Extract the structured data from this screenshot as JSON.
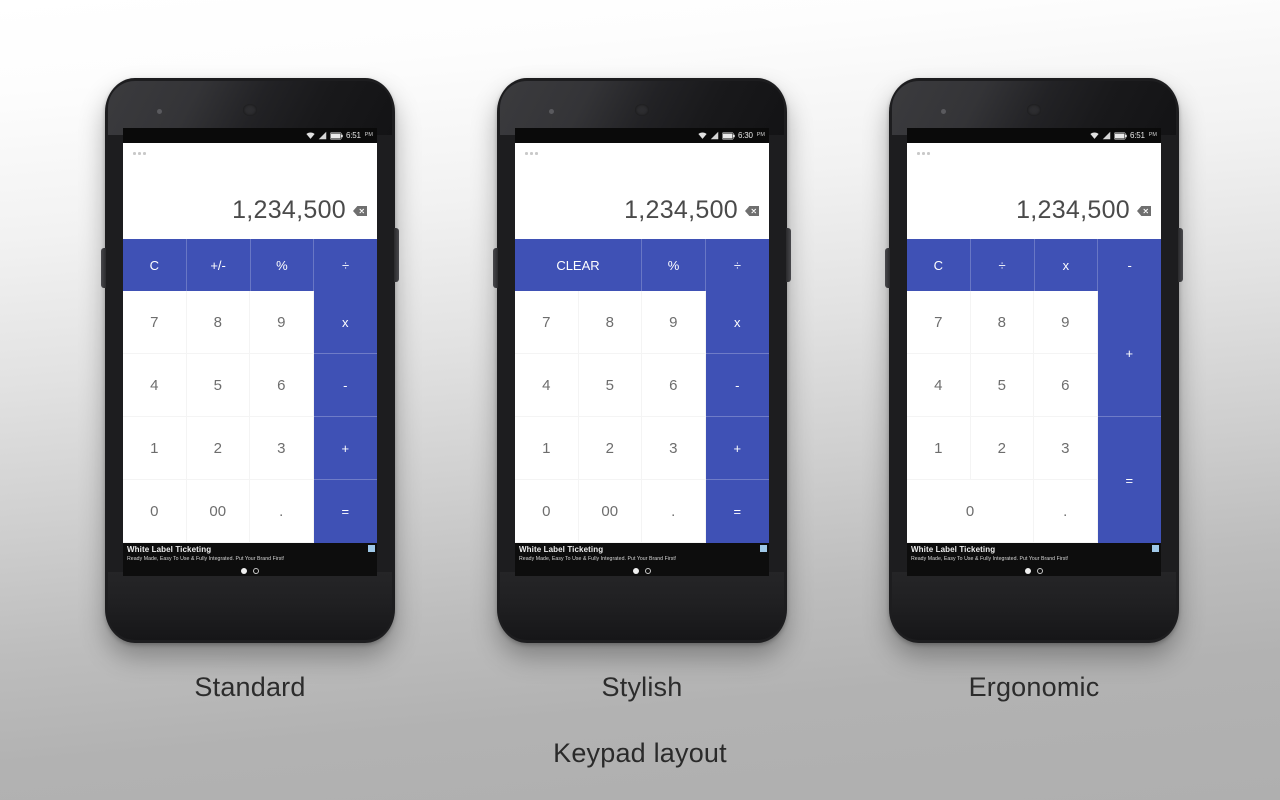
{
  "footer": {
    "label": "Keypad layout"
  },
  "theme": {
    "accent_blue": "#3f51b5",
    "display_text": "#4a4a4a",
    "digit_text": "#6d6d6d",
    "background_top": "#ffffff",
    "background_bottom": "#b0b0b0"
  },
  "phones": [
    {
      "caption": "Standard",
      "status": {
        "time": "6:51",
        "ampm": "PM"
      },
      "display": {
        "value": "1,234,500",
        "backspace_icon": "backspace-icon",
        "menu_icon": "overflow-menu-icon"
      },
      "opbar": [
        {
          "label": "C",
          "name": "clear-key",
          "wide": false
        },
        {
          "label": "+/-",
          "name": "sign-key",
          "wide": false
        },
        {
          "label": "%",
          "name": "percent-key",
          "wide": false
        },
        {
          "label": "÷",
          "name": "divide-key",
          "wide": false
        }
      ],
      "digits": [
        {
          "label": "7",
          "name": "digit-7",
          "span2": false
        },
        {
          "label": "8",
          "name": "digit-8",
          "span2": false
        },
        {
          "label": "9",
          "name": "digit-9",
          "span2": false
        },
        {
          "label": "4",
          "name": "digit-4",
          "span2": false
        },
        {
          "label": "5",
          "name": "digit-5",
          "span2": false
        },
        {
          "label": "6",
          "name": "digit-6",
          "span2": false
        },
        {
          "label": "1",
          "name": "digit-1",
          "span2": false
        },
        {
          "label": "2",
          "name": "digit-2",
          "span2": false
        },
        {
          "label": "3",
          "name": "digit-3",
          "span2": false
        },
        {
          "label": "0",
          "name": "digit-0",
          "span2": false
        },
        {
          "label": "00",
          "name": "digit-00",
          "span2": false
        },
        {
          "label": ".",
          "name": "decimal-point-key",
          "span2": false
        }
      ],
      "ops": [
        {
          "label": "x",
          "name": "multiply-key",
          "rspan2": false
        },
        {
          "label": "-",
          "name": "minus-key",
          "rspan2": false
        },
        {
          "label": "+",
          "name": "plus-key",
          "rspan2": false
        },
        {
          "label": "=",
          "name": "equals-key",
          "rspan2": false
        }
      ],
      "ad": {
        "title": "White Label Ticketing",
        "subtitle": "Ready Made, Easy To Use & Fully Integrated. Put Your Brand First!"
      }
    },
    {
      "caption": "Stylish",
      "status": {
        "time": "6:30",
        "ampm": "PM"
      },
      "display": {
        "value": "1,234,500",
        "backspace_icon": "backspace-icon",
        "menu_icon": "overflow-menu-icon"
      },
      "opbar": [
        {
          "label": "CLEAR",
          "name": "clear-key",
          "wide": true
        },
        {
          "label": "%",
          "name": "percent-key",
          "wide": false
        },
        {
          "label": "÷",
          "name": "divide-key",
          "wide": false
        }
      ],
      "digits": [
        {
          "label": "7",
          "name": "digit-7",
          "span2": false
        },
        {
          "label": "8",
          "name": "digit-8",
          "span2": false
        },
        {
          "label": "9",
          "name": "digit-9",
          "span2": false
        },
        {
          "label": "4",
          "name": "digit-4",
          "span2": false
        },
        {
          "label": "5",
          "name": "digit-5",
          "span2": false
        },
        {
          "label": "6",
          "name": "digit-6",
          "span2": false
        },
        {
          "label": "1",
          "name": "digit-1",
          "span2": false
        },
        {
          "label": "2",
          "name": "digit-2",
          "span2": false
        },
        {
          "label": "3",
          "name": "digit-3",
          "span2": false
        },
        {
          "label": "0",
          "name": "digit-0",
          "span2": false
        },
        {
          "label": "00",
          "name": "digit-00",
          "span2": false
        },
        {
          "label": ".",
          "name": "decimal-point-key",
          "span2": false
        }
      ],
      "ops": [
        {
          "label": "x",
          "name": "multiply-key",
          "rspan2": false
        },
        {
          "label": "-",
          "name": "minus-key",
          "rspan2": false
        },
        {
          "label": "+",
          "name": "plus-key",
          "rspan2": false
        },
        {
          "label": "=",
          "name": "equals-key",
          "rspan2": false
        }
      ],
      "ad": {
        "title": "White Label Ticketing",
        "subtitle": "Ready Made, Easy To Use & Fully Integrated. Put Your Brand First!"
      }
    },
    {
      "caption": "Ergonomic",
      "status": {
        "time": "6:51",
        "ampm": "PM"
      },
      "display": {
        "value": "1,234,500",
        "backspace_icon": "backspace-icon",
        "menu_icon": "overflow-menu-icon"
      },
      "opbar": [
        {
          "label": "C",
          "name": "clear-key",
          "wide": false
        },
        {
          "label": "÷",
          "name": "divide-key",
          "wide": false
        },
        {
          "label": "x",
          "name": "multiply-key",
          "wide": false
        },
        {
          "label": "-",
          "name": "minus-key",
          "wide": false
        }
      ],
      "digits": [
        {
          "label": "7",
          "name": "digit-7",
          "span2": false
        },
        {
          "label": "8",
          "name": "digit-8",
          "span2": false
        },
        {
          "label": "9",
          "name": "digit-9",
          "span2": false
        },
        {
          "label": "4",
          "name": "digit-4",
          "span2": false
        },
        {
          "label": "5",
          "name": "digit-5",
          "span2": false
        },
        {
          "label": "6",
          "name": "digit-6",
          "span2": false
        },
        {
          "label": "1",
          "name": "digit-1",
          "span2": false
        },
        {
          "label": "2",
          "name": "digit-2",
          "span2": false
        },
        {
          "label": "3",
          "name": "digit-3",
          "span2": false
        },
        {
          "label": "0",
          "name": "digit-0",
          "span2": true
        },
        {
          "label": ".",
          "name": "decimal-point-key",
          "span2": false
        }
      ],
      "ops": [
        {
          "label": "+",
          "name": "plus-key",
          "rspan2": true
        },
        {
          "label": "=",
          "name": "equals-key",
          "rspan2": true
        }
      ],
      "ad": {
        "title": "White Label Ticketing",
        "subtitle": "Ready Made, Easy To Use & Fully Integrated. Put Your Brand First!"
      }
    }
  ]
}
